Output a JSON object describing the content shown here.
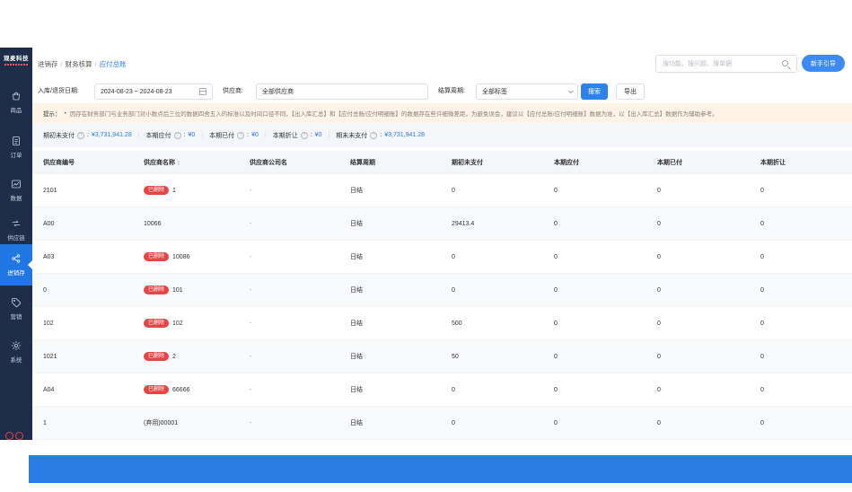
{
  "colors": {
    "accent": "#2b7ce5",
    "sidebar_bg": "#1f2c4a",
    "sidebar_active": "#2077e4",
    "badge_red": "#e64545",
    "hint_bg": "#fdf4e7",
    "bottom_bar_blue": "#2a7ce2"
  },
  "app": {
    "logo": "观麦科技"
  },
  "sidebar": {
    "items": [
      {
        "key": "goods",
        "label": "商品",
        "icon": "bag-icon",
        "active": false
      },
      {
        "key": "orders",
        "label": "订单",
        "icon": "order-icon",
        "active": false
      },
      {
        "key": "data",
        "label": "数据",
        "icon": "chart-icon",
        "active": false
      },
      {
        "key": "supply-chain",
        "label": "供应链",
        "icon": "supply-chain-icon",
        "active": false
      },
      {
        "key": "inventory",
        "label": "进销存",
        "icon": "inventory-icon",
        "active": true
      },
      {
        "key": "marketing",
        "label": "营销",
        "icon": "tag-icon",
        "active": false
      },
      {
        "key": "system",
        "label": "系统",
        "icon": "gear-icon",
        "active": false
      }
    ]
  },
  "breadcrumb": {
    "separator": "/",
    "items": [
      "进销存",
      "财务核算",
      "应付总账"
    ]
  },
  "topbar": {
    "search_placeholder": "搜功能、搜问题、搜单据",
    "guide_button": "新手引导"
  },
  "filters": {
    "date_label": "入库/退货日期:",
    "date_value": "2024-08-23 ~ 2024-08-23",
    "supplier_label": "供应商:",
    "supplier_value": "全部供应商",
    "period_label": "结算周期:",
    "period_value": "全部标签",
    "search_button": "搜索",
    "export_button": "导出"
  },
  "hint": {
    "label": "提示：",
    "bullet": "•",
    "text": "因存在财务部门与业务部门对小数点后三位的数据四舍五入的标准以及时间口径不同，【出入库汇总】和【应付总账/应付明细账】的数据存在些许细微差距，为避免误会，建议以【应付总账/应付明细账】数据为准，以【出入库汇总】数据作为辅助参考。"
  },
  "summary": {
    "colon": ":",
    "separator": "|",
    "items": [
      {
        "label": "期初未支付",
        "value": "¥3,731,941.28"
      },
      {
        "label": "本期应付",
        "value": "¥0"
      },
      {
        "label": "本期已付",
        "value": "¥0"
      },
      {
        "label": "本期折让",
        "value": "¥0"
      },
      {
        "label": "期末未支付",
        "value": "¥3,731,941.28"
      }
    ]
  },
  "table": {
    "deleted_badge": "已删除",
    "columns": [
      {
        "label": "供应商编号",
        "sortable": false
      },
      {
        "label": "供应商名称",
        "sortable": true
      },
      {
        "label": "供应商公司名",
        "sortable": false
      },
      {
        "label": "结算周期",
        "sortable": false
      },
      {
        "label": "期初未支付",
        "sortable": false
      },
      {
        "label": "本期应付",
        "sortable": false
      },
      {
        "label": "本期已付",
        "sortable": false
      },
      {
        "label": "本期折让",
        "sortable": false
      }
    ],
    "rows": [
      {
        "code": "2101",
        "deleted": true,
        "name": "1",
        "company": "-",
        "period": "日结",
        "opening": "0",
        "payable": "0",
        "paid": "0",
        "discount": "0"
      },
      {
        "code": "A00",
        "deleted": false,
        "name": "10066",
        "company": "-",
        "period": "日结",
        "opening": "29413.4",
        "payable": "0",
        "paid": "0",
        "discount": "0"
      },
      {
        "code": "A03",
        "deleted": true,
        "name": "10086",
        "company": "-",
        "period": "日结",
        "opening": "0",
        "payable": "0",
        "paid": "0",
        "discount": "0"
      },
      {
        "code": "0",
        "deleted": true,
        "name": "101",
        "company": "-",
        "period": "日结",
        "opening": "0",
        "payable": "0",
        "paid": "0",
        "discount": "0"
      },
      {
        "code": "102",
        "deleted": true,
        "name": "102",
        "company": "-",
        "period": "日结",
        "opening": "500",
        "payable": "0",
        "paid": "0",
        "discount": "0"
      },
      {
        "code": "1021",
        "deleted": true,
        "name": "2",
        "company": "-",
        "period": "日结",
        "opening": "50",
        "payable": "0",
        "paid": "0",
        "discount": "0"
      },
      {
        "code": "A04",
        "deleted": true,
        "name": "66666",
        "company": "-",
        "period": "日结",
        "opening": "0",
        "payable": "0",
        "paid": "0",
        "discount": "0"
      },
      {
        "code": "1",
        "deleted": false,
        "name": "(弃用)00001",
        "company": "-",
        "period": "日结",
        "opening": "0",
        "payable": "0",
        "paid": "0",
        "discount": "0"
      }
    ]
  }
}
